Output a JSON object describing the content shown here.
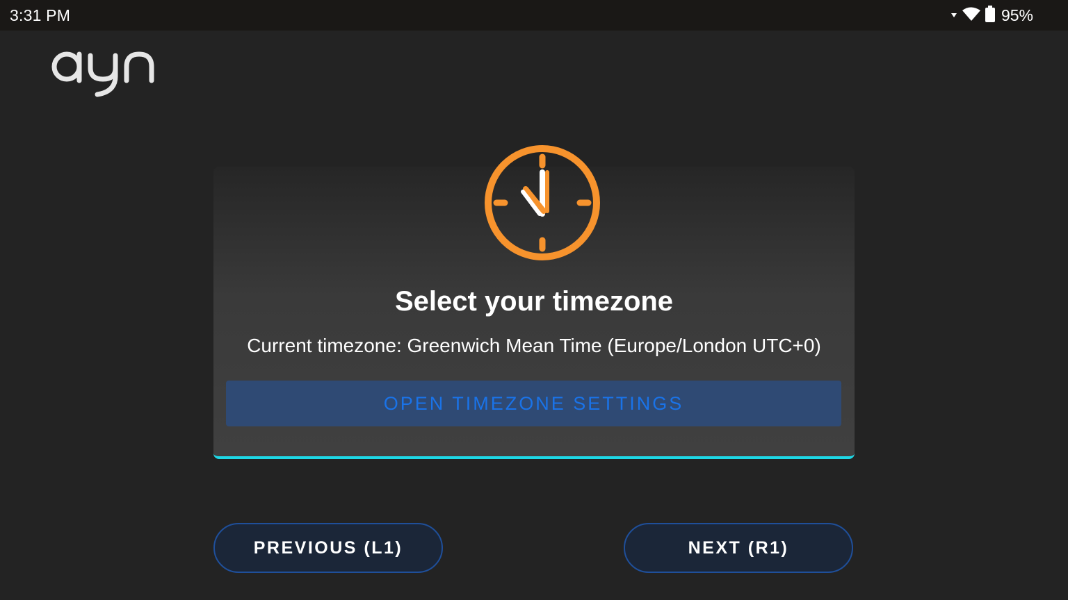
{
  "status_bar": {
    "time": "3:31 PM",
    "battery_percent": "95%",
    "icons": [
      "signal-arrow-icon",
      "wifi-icon",
      "battery-icon"
    ]
  },
  "brand": {
    "logo_text": "ayn"
  },
  "card": {
    "icon": "clock-icon",
    "title": "Select your timezone",
    "subtitle": "Current timezone: Greenwich Mean Time (Europe/London UTC+0)",
    "button_label": "OPEN TIMEZONE SETTINGS"
  },
  "navigation": {
    "previous_label": "PREVIOUS (L1)",
    "next_label": "NEXT (R1)"
  },
  "colors": {
    "background": "#232323",
    "accent_orange": "#f7932d",
    "accent_cyan": "#1ed8e6",
    "button_blue_text": "#1a73e8",
    "button_blue_bg": "#2f4a74",
    "nav_border": "#1f4f9a"
  }
}
